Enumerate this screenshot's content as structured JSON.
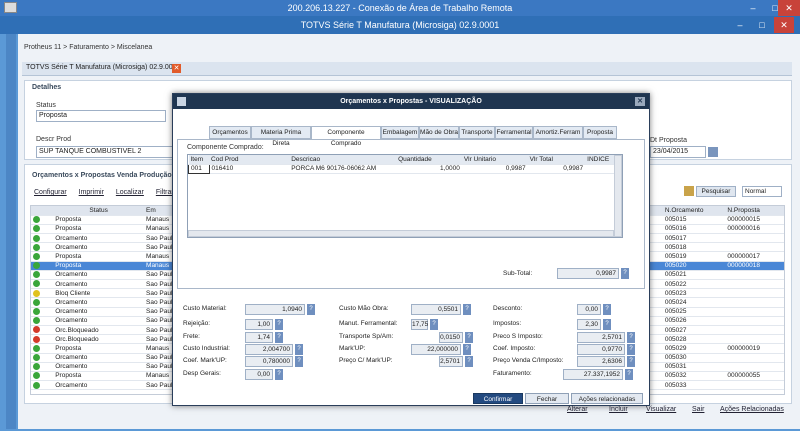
{
  "remote": {
    "title": "200.206.13.227 - Conexão de Área de Trabalho Remota"
  },
  "app": {
    "title": "TOTVS Série T Manufatura (Microsiga) 02.9.0001"
  },
  "breadcrumb": "Protheus 11 > Faturamento > Miscelanea",
  "tab": {
    "label": "TOTVS Série T Manufatura (Microsiga) 02.9.0005"
  },
  "detalhes": {
    "title": "Detalhes",
    "status_label": "Status",
    "status_value": "Proposta",
    "descr_label": "Descr Prod",
    "descr_value": "SUP TANQUE COMBUSTIVEL 2",
    "dt_label": "Dt Proposta",
    "dt_value": "23/04/2015"
  },
  "list": {
    "title": "Orçamentos x Propostas Venda Produção",
    "links": [
      "Configurar",
      "Imprimir",
      "Localizar",
      "Filtrar"
    ],
    "search_btn": "Pesquisar",
    "mode": "Normal",
    "col_status": "Status",
    "col_em": "Em",
    "col_norc": "N.Orcamento",
    "col_nprop": "N.Proposta",
    "rows": [
      {
        "status": "Proposta",
        "place": "Manaus",
        "norc": "005015",
        "nprop": "000000015",
        "color": "#3aa63a"
      },
      {
        "status": "Proposta",
        "place": "Manaus",
        "norc": "005016",
        "nprop": "000000016",
        "color": "#3aa63a"
      },
      {
        "status": "Orcamento",
        "place": "Sao Paulo",
        "norc": "005017",
        "nprop": "",
        "color": "#3aa63a"
      },
      {
        "status": "Orcamento",
        "place": "Sao Paulo",
        "norc": "005018",
        "nprop": "",
        "color": "#3aa63a"
      },
      {
        "status": "Proposta",
        "place": "Manaus",
        "norc": "005019",
        "nprop": "000000017",
        "color": "#3aa63a"
      },
      {
        "status": "Proposta",
        "place": "Manaus",
        "norc": "005020",
        "nprop": "000000018",
        "color": "#3aa63a"
      },
      {
        "status": "Orcamento",
        "place": "Sao Paulo",
        "norc": "005021",
        "nprop": "",
        "color": "#3aa63a"
      },
      {
        "status": "Orcamento",
        "place": "Sao Paulo",
        "norc": "005022",
        "nprop": "",
        "color": "#3aa63a"
      },
      {
        "status": "Bloq Cliente",
        "place": "Sao Paulo",
        "norc": "005023",
        "nprop": "",
        "color": "#e0c21e"
      },
      {
        "status": "Orcamento",
        "place": "Sao Paulo",
        "norc": "005024",
        "nprop": "",
        "color": "#3aa63a"
      },
      {
        "status": "Orcamento",
        "place": "Sao Paulo",
        "norc": "005025",
        "nprop": "",
        "color": "#3aa63a"
      },
      {
        "status": "Orcamento",
        "place": "Sao Paulo",
        "norc": "005026",
        "nprop": "",
        "color": "#3aa63a"
      },
      {
        "status": "Orc.Bloqueado",
        "place": "Sao Paulo",
        "norc": "005027",
        "nprop": "",
        "color": "#d43a2a"
      },
      {
        "status": "Orc.Bloqueado",
        "place": "Sao Paulo",
        "norc": "005028",
        "nprop": "",
        "color": "#d43a2a"
      },
      {
        "status": "Proposta",
        "place": "Manaus",
        "norc": "005029",
        "nprop": "000000019",
        "color": "#3aa63a"
      },
      {
        "status": "Orcamento",
        "place": "Sao Paulo",
        "norc": "005030",
        "nprop": "",
        "color": "#3aa63a"
      },
      {
        "status": "Orcamento",
        "place": "Sao Paulo",
        "norc": "005031",
        "nprop": "",
        "color": "#3aa63a"
      },
      {
        "status": "Proposta",
        "place": "Manaus",
        "norc": "005032",
        "nprop": "000000055",
        "color": "#3aa63a"
      },
      {
        "status": "Orcamento",
        "place": "Sao Paulo",
        "norc": "005033",
        "nprop": "",
        "color": "#3aa63a"
      }
    ]
  },
  "modal": {
    "title": "Orçamentos x Propostas - VISUALIZAÇÃO",
    "tabs": [
      "Orçamentos",
      "Materia Prima Direta",
      "Componente Comprado",
      "Embalagem",
      "Mão de Obra",
      "Transporte",
      "Ferramental",
      "Amortiz.Ferram",
      "Proposta"
    ],
    "section": "Componente Comprado:",
    "cols": [
      "Item",
      "Cod Prod",
      "Descricao",
      "Quantidade",
      "Vlr Unitario",
      "Vlr Total",
      "INDICE"
    ],
    "row": [
      "001",
      "016410",
      "PORCA  M6 90176-06062 AM",
      "1,0000",
      "0,9987",
      "0,9987",
      ""
    ],
    "subtotal_label": "Sub-Total:",
    "subtotal": "0,9987",
    "fields": {
      "custo_material": [
        "Custo Material:",
        "1,0940"
      ],
      "rejeicao": [
        "Rejeição:",
        "1,00"
      ],
      "frete": [
        "Frete:",
        "1,74"
      ],
      "custo_industrial": [
        "Custo Industrial:",
        "2,004700"
      ],
      "coef_markup": [
        "Coef. Mark'UP:",
        "0,780000"
      ],
      "desp_gerais": [
        "Desp Gerais:",
        "0,00"
      ],
      "custo_mao_obra": [
        "Custo Mão Obra:",
        "0,5501"
      ],
      "manut_ferramental": [
        "Manut. Ferramental:",
        "17,75"
      ],
      "transporte": [
        "Transporte Sp/Am:",
        "0,0150"
      ],
      "markup": [
        "Mark'UP:",
        "22,000000"
      ],
      "preco_markup": [
        "Preço C/ Mark'UP:",
        "2,5701"
      ],
      "desconto": [
        "Desconto:",
        "0,00"
      ],
      "impostos": [
        "Impostos:",
        "2,30"
      ],
      "preco_s_imposto": [
        "Preco S Imposto:",
        "2,5701"
      ],
      "coef_imposto": [
        "Coef. Imposto:",
        "0,9770"
      ],
      "preco_venda": [
        "Preço Venda C/Imposto:",
        "2,6306"
      ],
      "faturamento": [
        "Faturamento:",
        "27.337,1952"
      ]
    },
    "btn_confirm": "Confirmar",
    "btn_close": "Fechar",
    "btn_actions": "Ações relacionadas"
  },
  "bottom": [
    "Alterar",
    "Incluir",
    "Visualizar",
    "Sair",
    "Ações Relacionadas"
  ],
  "colors": {
    "titlebar": "#2f6fb6",
    "modal_title": "#1f3550",
    "selected_row": "#4a87d6",
    "primary_button": "#234a80"
  }
}
